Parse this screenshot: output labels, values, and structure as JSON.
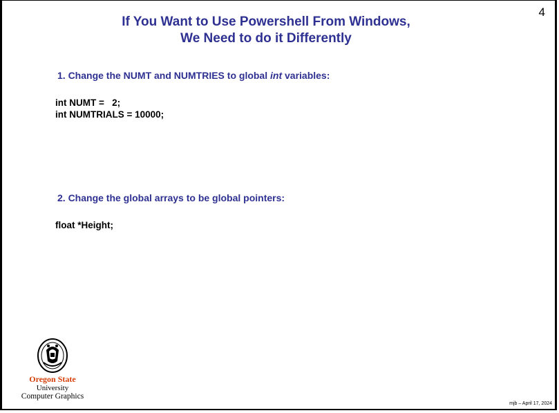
{
  "slide": {
    "page_number": "4",
    "title_line1": "If You Want to Use Powershell From Windows,",
    "title_line2": "We Need to do it Differently",
    "step1": {
      "prefix": "1. Change the NUMT and NUMTRIES to global ",
      "emphasis": "int",
      "suffix": " variables:"
    },
    "code1": [
      "int NUMT =   2;",
      "int NUMTRIALS = 10000;"
    ],
    "step2": "2. Change the global arrays to be global pointers:",
    "code2": [
      "float *Height;"
    ],
    "logo": {
      "line1": "Oregon State",
      "line2": "University",
      "line3": "Computer Graphics"
    },
    "footer": "mjb – April 17, 2024"
  },
  "colors": {
    "title": "#2e3192",
    "logo_orange": "#d73f09"
  }
}
